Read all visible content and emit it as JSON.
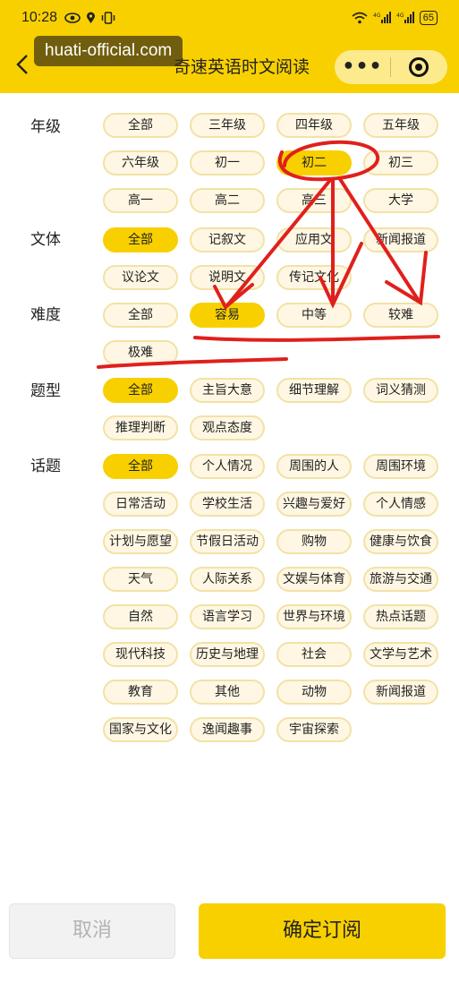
{
  "status_bar": {
    "time": "10:28",
    "left_icons": [
      "eye-icon",
      "location-icon",
      "vibrate-icon"
    ],
    "right_icons": [
      "wifi-icon",
      "signal-4g-icon",
      "signal-4g-icon"
    ],
    "battery": "65"
  },
  "header": {
    "watermark": "huati-official.com",
    "title": "奇速英语时文阅读",
    "back_icon": "back-arrow-icon",
    "more_icon": "more-dots-icon",
    "target_icon": "target-icon"
  },
  "colors": {
    "accent": "#f8d000",
    "chip_bg": "#fff7e3",
    "chip_border": "#f1e2a6",
    "annotation": "#e0201c"
  },
  "filters": {
    "grade": {
      "label": "年级",
      "options": [
        "全部",
        "三年级",
        "四年级",
        "五年级",
        "六年级",
        "初一",
        "初二",
        "初三",
        "高一",
        "高二",
        "高三",
        "大学"
      ],
      "selected": "初二"
    },
    "genre": {
      "label": "文体",
      "options": [
        "全部",
        "记叙文",
        "应用文",
        "新闻报道",
        "议论文",
        "说明文",
        "传记文化"
      ],
      "selected": "全部"
    },
    "difficulty": {
      "label": "难度",
      "options": [
        "全部",
        "容易",
        "中等",
        "较难",
        "极难"
      ],
      "selected": "容易"
    },
    "question_type": {
      "label": "题型",
      "options": [
        "全部",
        "主旨大意",
        "细节理解",
        "词义猜测",
        "推理判断",
        "观点态度"
      ],
      "selected": "全部"
    },
    "topic": {
      "label": "话题",
      "options": [
        "全部",
        "个人情况",
        "周围的人",
        "周围环境",
        "日常活动",
        "学校生活",
        "兴趣与爱好",
        "个人情感",
        "计划与愿望",
        "节假日活动",
        "购物",
        "健康与饮食",
        "天气",
        "人际关系",
        "文娱与体育",
        "旅游与交通",
        "自然",
        "语言学习",
        "世界与环境",
        "热点话题",
        "现代科技",
        "历史与地理",
        "社会",
        "文学与艺术",
        "教育",
        "其他",
        "动物",
        "新闻报道",
        "国家与文化",
        "逸闻趣事",
        "宇宙探索"
      ],
      "selected": "全部"
    }
  },
  "footer": {
    "cancel_label": "取消",
    "confirm_label": "确定订阅"
  }
}
